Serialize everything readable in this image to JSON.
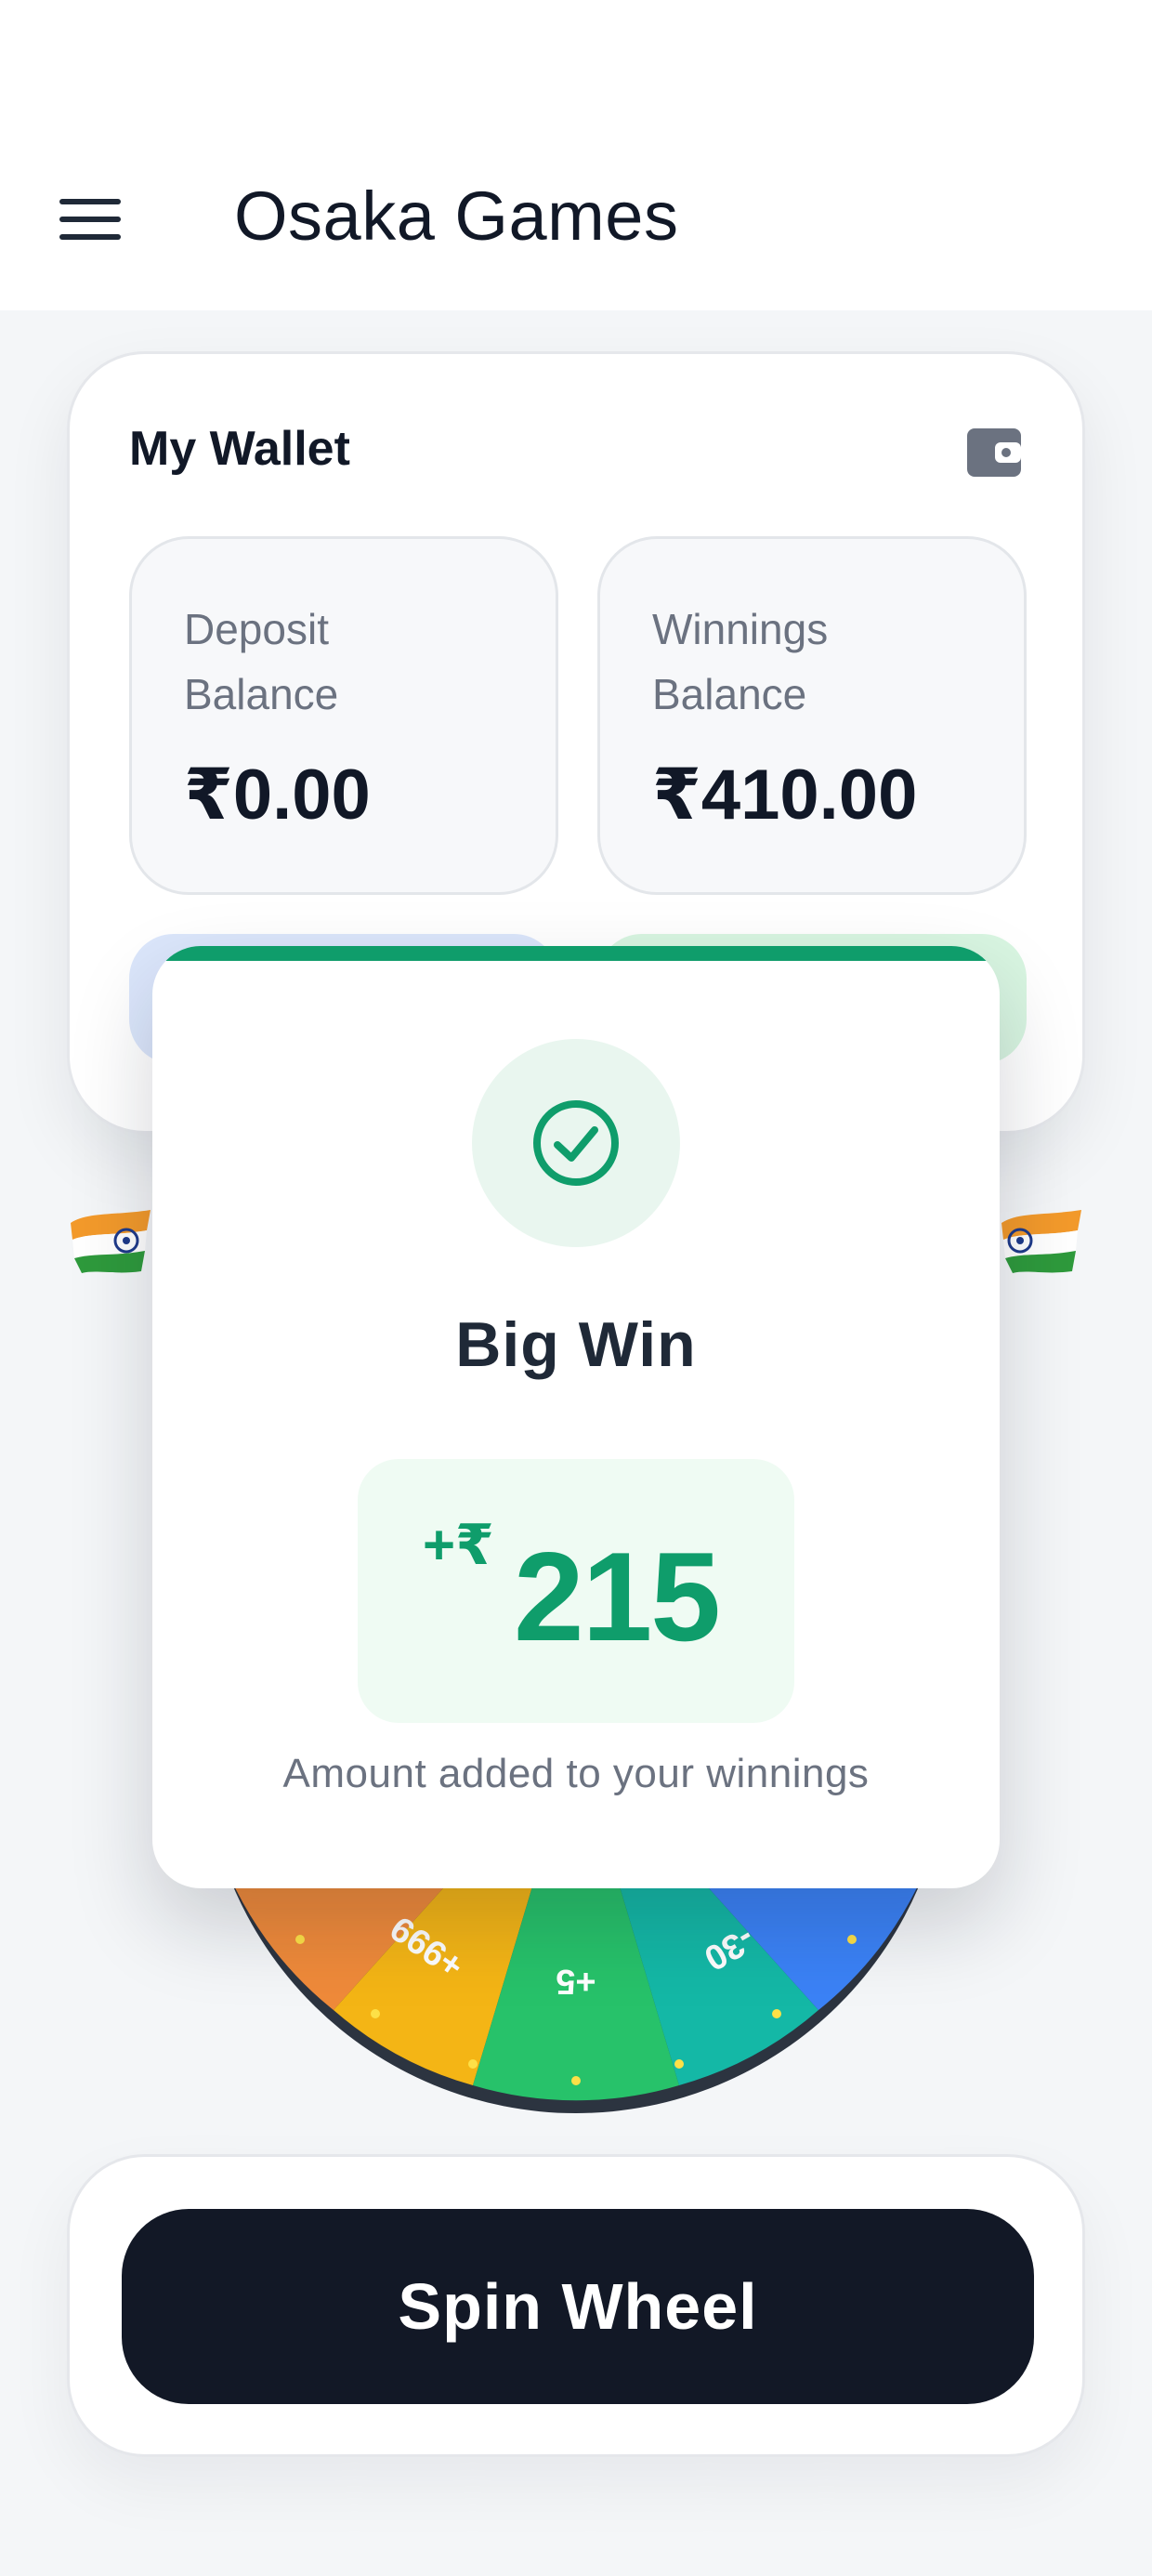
{
  "header": {
    "menu_icon": "hamburger-menu-icon",
    "title": "Osaka Games"
  },
  "wallet": {
    "title": "My Wallet",
    "icon": "wallet-icon",
    "deposit": {
      "label": "Deposit Balance",
      "value": "₹0.00"
    },
    "winnings": {
      "label": "Winnings Balance",
      "value": "₹410.00"
    }
  },
  "decor": {
    "flag_icon": "india-flag-icon"
  },
  "wheel": {
    "visible_segments": [
      {
        "label": "+999",
        "color": "#f4b515"
      },
      {
        "label": "+5",
        "color": "#27c26a"
      },
      {
        "label": "-30",
        "color": "#14b8a6"
      }
    ],
    "rim_color": "#2c3440"
  },
  "dialog": {
    "icon": "check-circle-icon",
    "title": "Big Win",
    "amount_prefix": "+₹",
    "amount": "215",
    "note": "Amount added to your winnings",
    "accent_color": "#0f9d6b"
  },
  "actions": {
    "spin_label": "Spin Wheel"
  }
}
